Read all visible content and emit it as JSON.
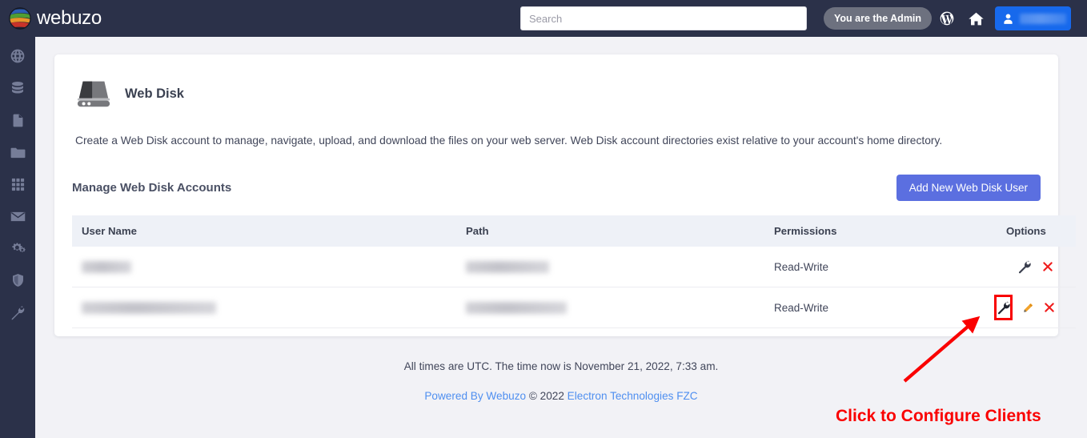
{
  "topbar": {
    "brand": "webuzo",
    "brand_logo_icon": "webuzo-globe-logo",
    "search": {
      "value": "",
      "placeholder": "Search"
    },
    "admin_badge": "You are the Admin",
    "wordpress_icon": "wordpress-icon",
    "home_icon": "home-icon",
    "user_button": {
      "icon": "user-icon",
      "label_redacted": true
    }
  },
  "sidebar": {
    "items": [
      {
        "icon": "globe-icon",
        "name": "domains"
      },
      {
        "icon": "database-icon",
        "name": "databases"
      },
      {
        "icon": "file-icon",
        "name": "files"
      },
      {
        "icon": "folder-icon",
        "name": "folders"
      },
      {
        "icon": "grid-apps-icon",
        "name": "apps"
      },
      {
        "icon": "envelope-icon",
        "name": "email"
      },
      {
        "icon": "gears-icon",
        "name": "settings"
      },
      {
        "icon": "shield-icon",
        "name": "security"
      },
      {
        "icon": "wrench-icon",
        "name": "tools"
      }
    ]
  },
  "card": {
    "icon": "web-disk-icon",
    "title": "Web Disk",
    "description": "Create a Web Disk account to manage, navigate, upload, and download the files on your web server. Web Disk account directories exist relative to your account's home directory.",
    "section_title": "Manage Web Disk Accounts",
    "add_button": "Add New Web Disk User"
  },
  "table": {
    "columns": [
      "User Name",
      "Path",
      "Permissions",
      "Options"
    ],
    "rows": [
      {
        "user_name": "",
        "user_name_redacted": true,
        "path": "",
        "path_redacted": true,
        "permissions": "Read-Write",
        "options": [
          "configure-wrench-icon",
          "delete-x-icon"
        ]
      },
      {
        "user_name": "",
        "user_name_redacted": true,
        "path": "",
        "path_redacted": true,
        "permissions": "Read-Write",
        "options": [
          "configure-wrench-icon",
          "edit-pencil-icon",
          "delete-x-icon"
        ]
      }
    ]
  },
  "footer": {
    "time_note": "All times are UTC. The time now is November 21, 2022, 7:33 am.",
    "powered_by": "Powered By Webuzo",
    "copyright": "© 2022",
    "company": "Electron Technologies FZC"
  },
  "annotation": {
    "text": "Click to Configure Clients",
    "color": "#fa0000",
    "arrow": "red-arrow-pointing-up-right",
    "highlight_box": "red-rect-around-wrench"
  },
  "colors": {
    "topbar_bg": "#2b3149",
    "sidebar_bg": "#2b3149",
    "page_bg": "#f2f2f6",
    "card_bg": "#ffffff",
    "primary_button": "#5b6fe0",
    "user_button": "#1769ec",
    "link": "#4f8ff0",
    "annotation_red": "#fa0000",
    "table_header_bg": "#eef1f7"
  }
}
